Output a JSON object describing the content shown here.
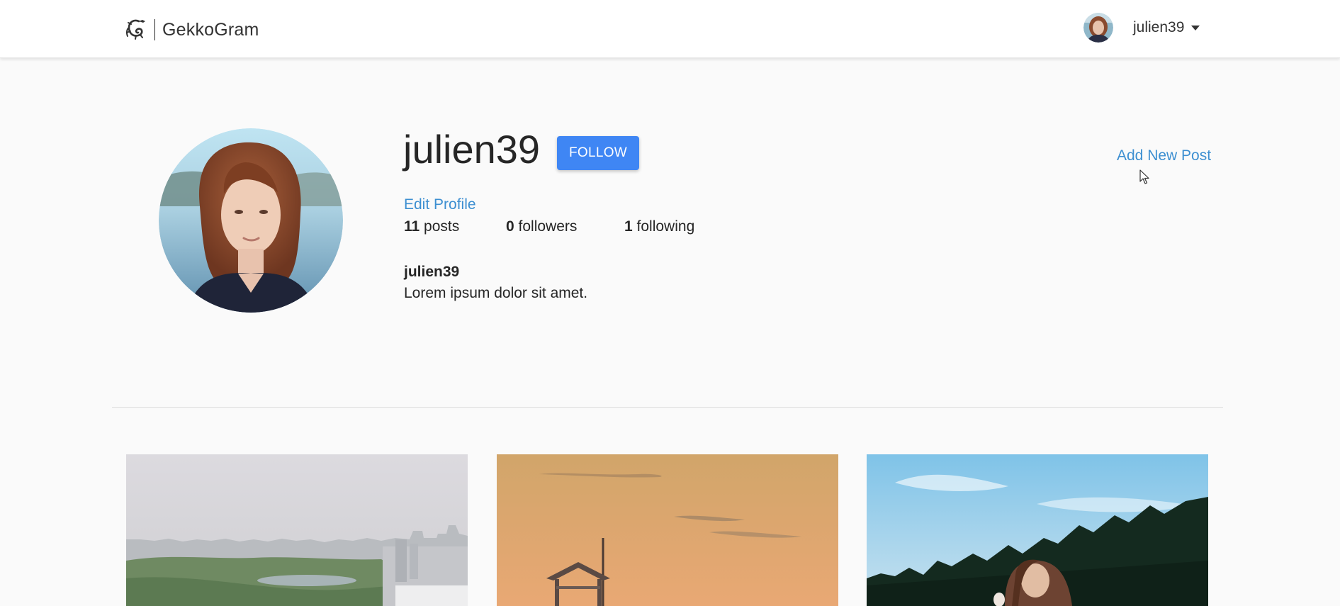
{
  "navbar": {
    "brand_name": "GekkoGram",
    "current_user": "julien39"
  },
  "profile": {
    "username": "julien39",
    "follow_label": "FOLLOW",
    "add_post_label": "Add New Post",
    "edit_profile_label": "Edit Profile",
    "stats": {
      "posts_count": "11",
      "posts_label": "posts",
      "followers_count": "0",
      "followers_label": "followers",
      "following_count": "1",
      "following_label": "following"
    },
    "bio_name": "julien39",
    "bio_text": "Lorem ipsum dolor sit amet."
  },
  "colors": {
    "accent": "#3f86f4",
    "link": "#3d8fd1",
    "background": "#fafafa"
  },
  "icons": {
    "brand": "gecko-logo-icon",
    "dropdown": "caret-down-icon",
    "cursor": "mouse-pointer-icon"
  }
}
